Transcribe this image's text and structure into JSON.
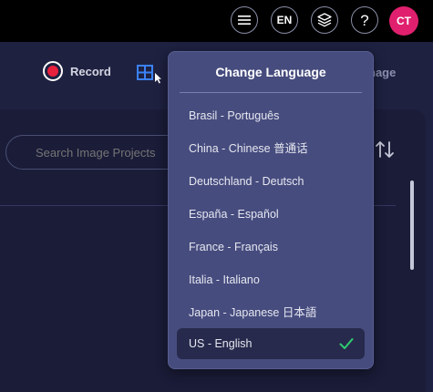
{
  "topbar": {
    "language_button": "EN",
    "help_button": "?",
    "avatar_initials": "CT",
    "avatar_color": "#e0206e"
  },
  "toolbar": {
    "record_label": "Record",
    "image_label_fragment": "nage"
  },
  "projects": {
    "search_placeholder": "Search Image Projects"
  },
  "language_menu": {
    "title": "Change Language",
    "options": [
      {
        "label": "Brasil - Português"
      },
      {
        "label": "China - Chinese 普通话"
      },
      {
        "label": "Deutschland - Deutsch"
      },
      {
        "label": "España - Español"
      },
      {
        "label": "France - Français"
      },
      {
        "label": "Italia - Italiano"
      },
      {
        "label": "Japan - Japanese 日本語"
      },
      {
        "label": "US - English"
      }
    ],
    "selected": "US - English",
    "check_color": "#2ecc71"
  },
  "icons": {
    "menu": "hamburger-menu-icon",
    "layers": "layers-icon",
    "grid": "grid-cursor-icon",
    "sort": "sort-arrows-icon",
    "record": "record-icon",
    "check": "check-icon"
  }
}
